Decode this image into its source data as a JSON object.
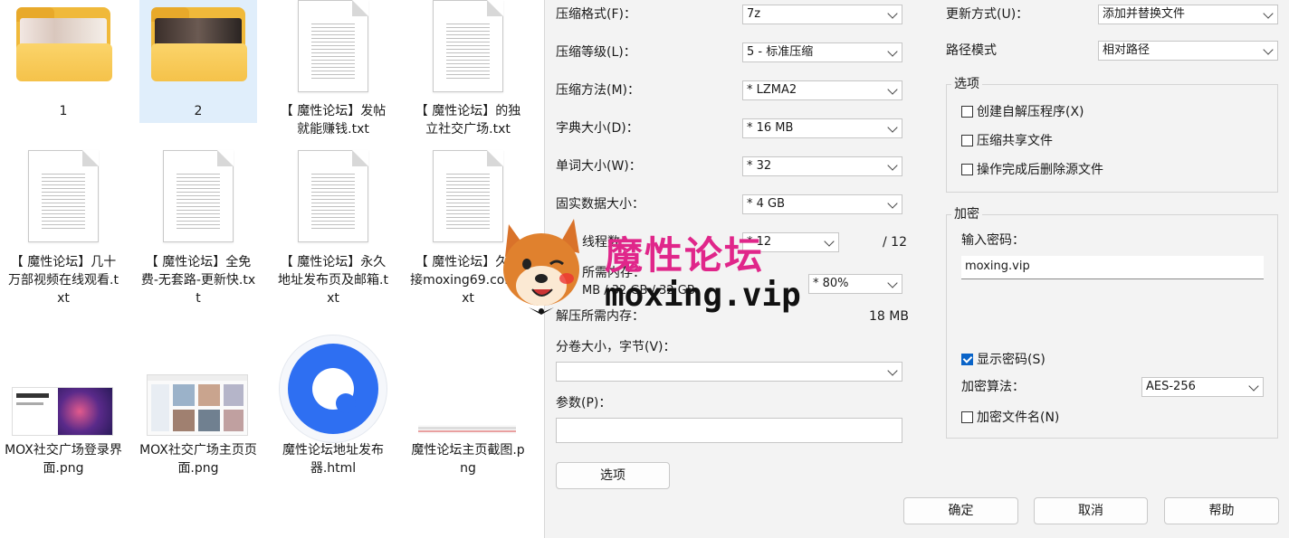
{
  "explorer": {
    "files": [
      {
        "name": "1",
        "kind": "folder"
      },
      {
        "name": "2",
        "kind": "folder",
        "selected": true
      },
      {
        "name": "【 魔性论坛】发帖就能赚钱.txt",
        "kind": "txt"
      },
      {
        "name": "【 魔性论坛】的独立社交广场.txt",
        "kind": "txt"
      },
      {
        "name": "【 魔性论坛】几十万部视频在线观看.txt",
        "kind": "txt"
      },
      {
        "name": "【 魔性论坛】全免费-无套路-更新快.txt",
        "kind": "txt"
      },
      {
        "name": "【 魔性论坛】永久地址发布页及邮箱.txt",
        "kind": "txt"
      },
      {
        "name": "【 魔性论坛】久链接moxing69.com.txt",
        "kind": "txt"
      },
      {
        "name": "MOX社交广场登录界面.png",
        "kind": "png"
      },
      {
        "name": "MOX社交广场主页页面.png",
        "kind": "png"
      },
      {
        "name": "魔性论坛地址发布器.html",
        "kind": "html"
      },
      {
        "name": "魔性论坛主页截图.png",
        "kind": "png"
      }
    ]
  },
  "dialog": {
    "format_label": "压缩格式(F)：",
    "format_value": "7z",
    "level_label": "压缩等级(L)：",
    "level_value": "5 - 标准压缩",
    "method_label": "压缩方法(M)：",
    "method_value": "* LZMA2",
    "dict_label": "字典大小(D)：",
    "dict_value": "* 16 MB",
    "word_label": "单词大小(W)：",
    "word_value": "* 32",
    "solid_label": "固实数据大小：",
    "solid_value": "* 4 GB",
    "threads_label": "线程数：",
    "threads_value": "* 12",
    "threads_total": "/ 12",
    "mem_label": "所需内存：",
    "mem_detail": "MB / 32 GB / 32 GB",
    "mem_value": "* 80%",
    "decomp_label": "解压所需内存：",
    "decomp_value": "18 MB",
    "volume_label": "分卷大小，字节(V)：",
    "volume_value": "",
    "params_label": "参数(P)：",
    "params_value": "",
    "options_button": "选项",
    "update_label": "更新方式(U)：",
    "update_value": "添加并替换文件",
    "path_label": "路径模式",
    "path_value": "相对路径",
    "options_group": "选项",
    "opt_sfx": "创建自解压程序(X)",
    "opt_shared": "压缩共享文件",
    "opt_delete": "操作完成后删除源文件",
    "encrypt_group": "加密",
    "password_label": "输入密码：",
    "password_value": "moxing.vip",
    "show_password": "显示密码(S)",
    "algo_label": "加密算法：",
    "algo_value": "AES-256",
    "encrypt_names": "加密文件名(N)",
    "ok": "确定",
    "cancel": "取消",
    "help": "帮助"
  },
  "watermark": {
    "title": "魔性论坛",
    "url": "moxing.vip"
  },
  "colors": {
    "accent": "#0a64c8",
    "watermark": "#e0268a",
    "folder": "#f5c24a"
  }
}
